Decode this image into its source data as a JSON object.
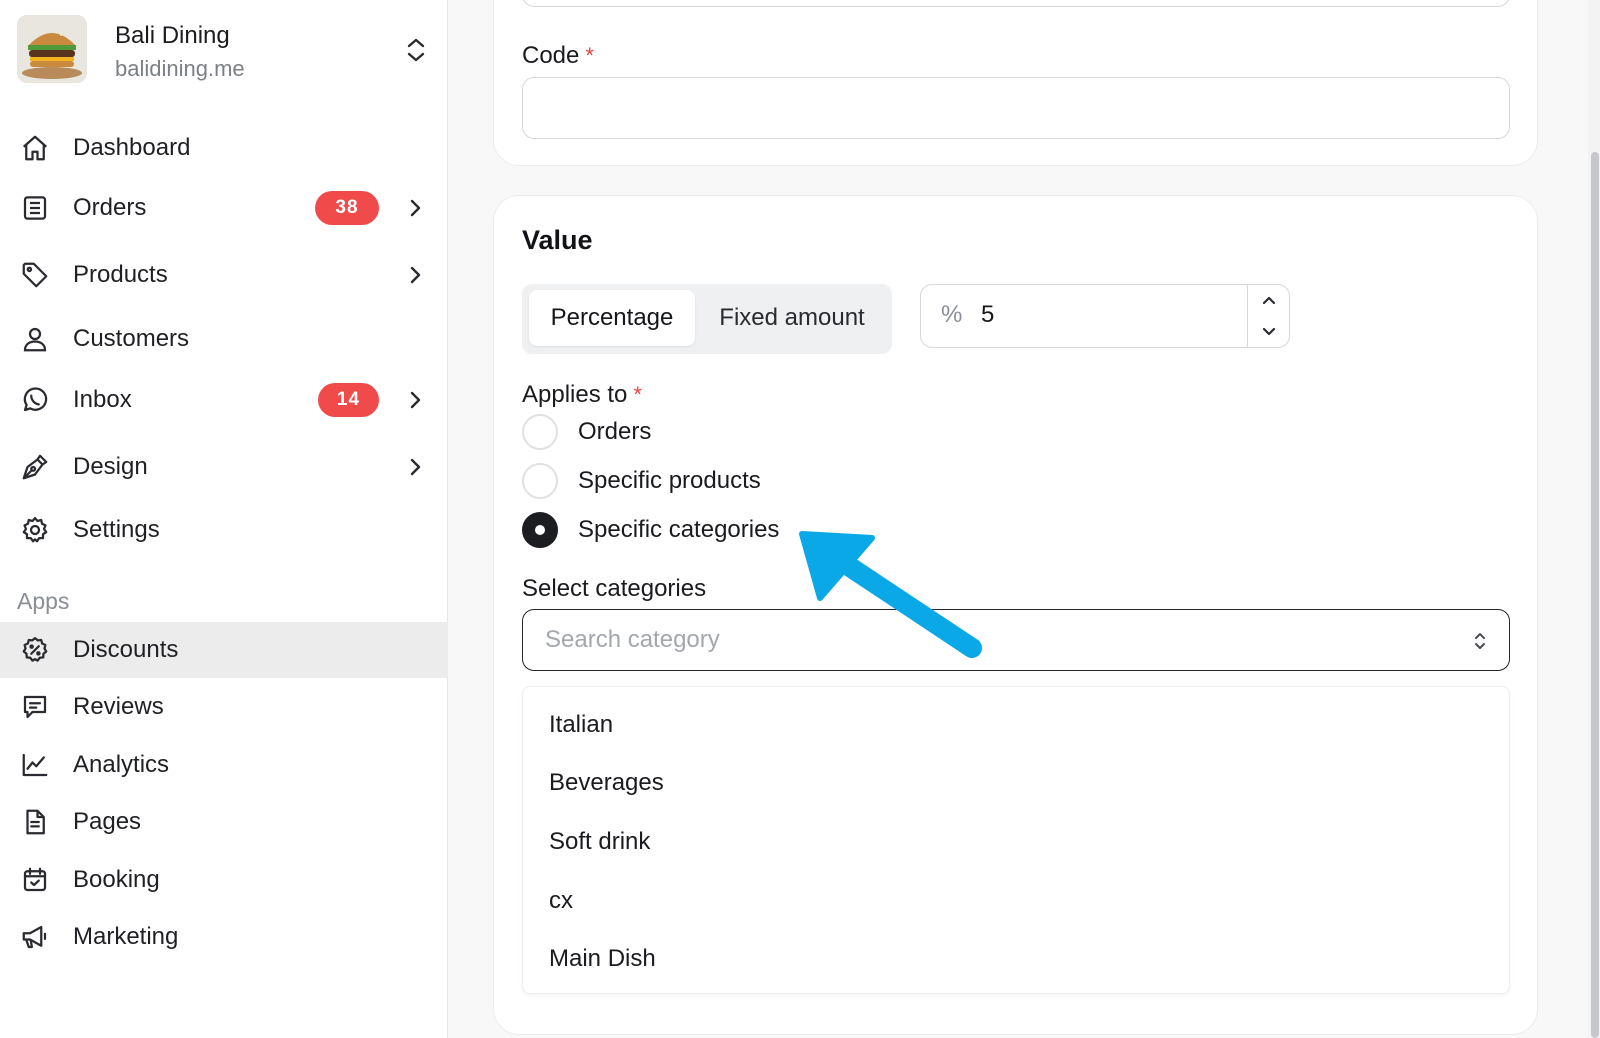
{
  "brand": {
    "name": "Bali Dining",
    "domain": "balidining.me"
  },
  "nav": {
    "dashboard": "Dashboard",
    "orders": "Orders",
    "orders_badge": "38",
    "products": "Products",
    "customers": "Customers",
    "inbox": "Inbox",
    "inbox_badge": "14",
    "design": "Design",
    "settings": "Settings",
    "apps_section": "Apps",
    "discounts": "Discounts",
    "reviews": "Reviews",
    "analytics": "Analytics",
    "pages": "Pages",
    "booking": "Booking",
    "marketing": "Marketing"
  },
  "form": {
    "code_label": "Code",
    "code_value": "",
    "required_mark": "*",
    "value_title": "Value",
    "type_options": [
      "Percentage",
      "Fixed amount"
    ],
    "type_selected": "Percentage",
    "value_prefix": "%",
    "value_amount": "5",
    "applies_to_label": "Applies to",
    "applies_options": [
      "Orders",
      "Specific products",
      "Specific categories"
    ],
    "applies_selected": "Specific categories",
    "select_categories_label": "Select categories",
    "search_placeholder": "Search category",
    "category_options": [
      "Italian",
      "Beverages",
      "Soft drink",
      "cx",
      "Main Dish"
    ]
  },
  "colors": {
    "badge": "#f04a4a",
    "arrow": "#0aa8e6",
    "required": "#ef4444"
  }
}
